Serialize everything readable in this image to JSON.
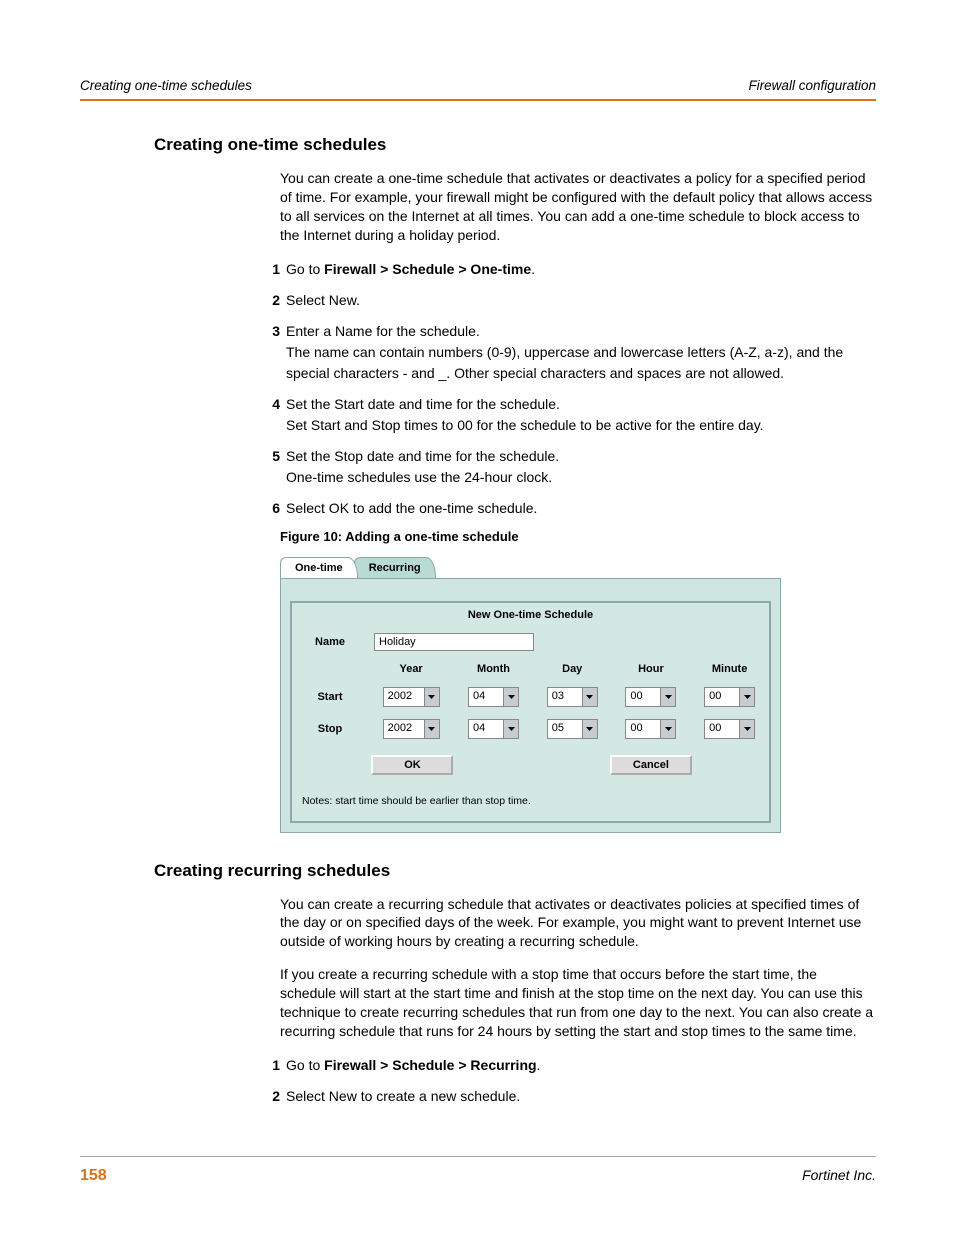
{
  "header": {
    "left": "Creating one-time schedules",
    "right": "Firewall configuration"
  },
  "section1": {
    "title": "Creating one-time schedules",
    "intro": "You can create a one-time schedule that activates or deactivates a policy for a specified period of time. For example, your firewall might be configured with the default policy that allows access to all services on the Internet at all times. You can add a one-time schedule to block access to the Internet during a holiday period.",
    "steps": {
      "s1": {
        "num": "1",
        "prefix": "Go to ",
        "bold": "Firewall > Schedule > One-time",
        "suffix": "."
      },
      "s2": {
        "num": "2",
        "text": "Select New."
      },
      "s3": {
        "num": "3",
        "line1": "Enter a Name for the schedule.",
        "line2": "The name can contain numbers (0-9), uppercase and lowercase letters (A-Z, a-z), and the special characters - and _. Other special characters and spaces are not allowed."
      },
      "s4": {
        "num": "4",
        "line1": "Set the Start date and time for the schedule.",
        "line2": "Set Start and Stop times to 00 for the schedule to be active for the entire day."
      },
      "s5": {
        "num": "5",
        "line1": "Set the Stop date and time for the schedule.",
        "line2": "One-time schedules use the 24-hour clock."
      },
      "s6": {
        "num": "6",
        "text": "Select OK to add the one-time schedule."
      }
    },
    "figure_caption": "Figure 10: Adding a one-time schedule"
  },
  "figure": {
    "tab_active": "One-time",
    "tab_inactive": "Recurring",
    "form_title": "New One-time Schedule",
    "labels": {
      "name": "Name",
      "start": "Start",
      "stop": "Stop"
    },
    "columns": {
      "year": "Year",
      "month": "Month",
      "day": "Day",
      "hour": "Hour",
      "minute": "Minute"
    },
    "name_value": "Holiday",
    "start": {
      "year": "2002",
      "month": "04",
      "day": "03",
      "hour": "00",
      "minute": "00"
    },
    "stop": {
      "year": "2002",
      "month": "04",
      "day": "05",
      "hour": "00",
      "minute": "00"
    },
    "ok": "OK",
    "cancel": "Cancel",
    "notes": "Notes: start time should be earlier than stop time."
  },
  "section2": {
    "title": "Creating recurring schedules",
    "p1": "You can create a recurring schedule that activates or deactivates policies at specified times of the day or on specified days of the week. For example, you might want to prevent Internet use outside of working hours by creating a recurring schedule.",
    "p2": "If you create a recurring schedule with a stop time that occurs before the start time, the schedule will start at the start time and finish at the stop time on the next day. You can use this technique to create recurring schedules that run from one day to the next. You can also create a recurring schedule that runs for 24 hours by setting the start and stop times to the same time.",
    "steps": {
      "s1": {
        "num": "1",
        "prefix": "Go to ",
        "bold": "Firewall > Schedule > Recurring",
        "suffix": "."
      },
      "s2": {
        "num": "2",
        "text": "Select New to create a new schedule."
      }
    }
  },
  "footer": {
    "page": "158",
    "vendor": "Fortinet Inc."
  }
}
